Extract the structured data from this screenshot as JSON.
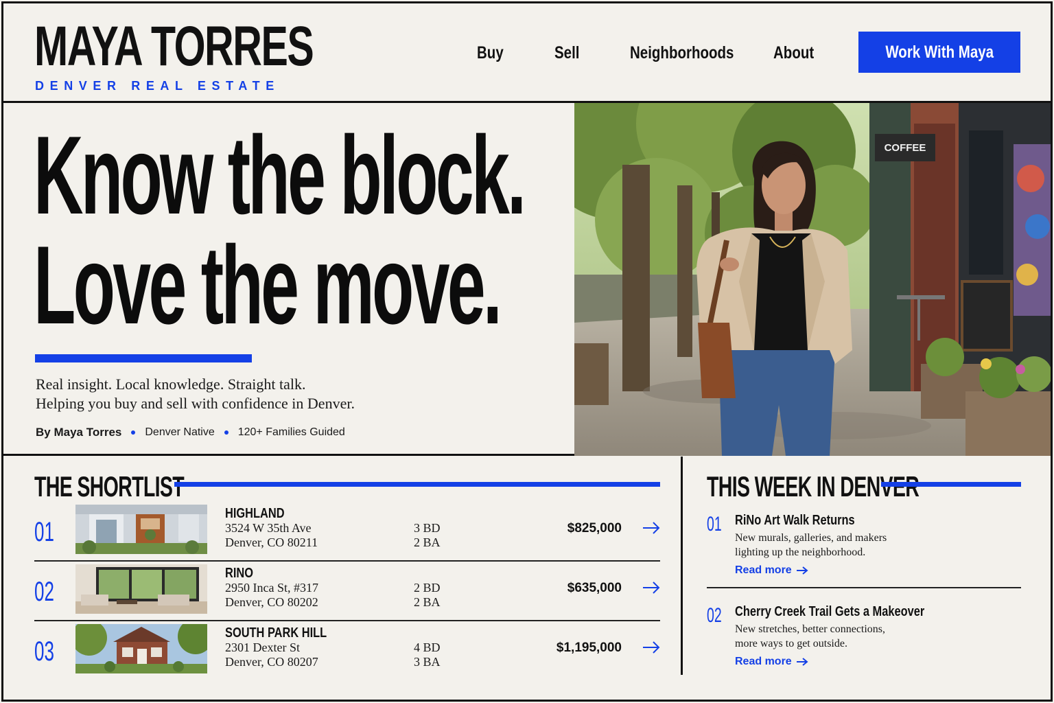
{
  "header": {
    "logo_name": "MAYA TORRES",
    "logo_sub": "DENVER REAL ESTATE",
    "nav": [
      "Buy",
      "Sell",
      "Neighborhoods",
      "About"
    ],
    "cta": "Work With Maya"
  },
  "hero": {
    "headline_1": "Know the block.",
    "headline_2": "Love the move.",
    "copy_1": "Real insight. Local knowledge. Straight talk.",
    "copy_2": "Helping you buy and sell with confidence in Denver.",
    "byline": "By Maya Torres",
    "tag_1": "Denver Native",
    "tag_2": "120+ Families Guided",
    "photo_signs": [
      "COFFEE"
    ]
  },
  "shortlist": {
    "title": "THE SHORTLIST",
    "items": [
      {
        "num": "01",
        "neighborhood": "HIGHLAND",
        "street": "3524 W 35th Ave",
        "city": "Denver, CO 80211",
        "beds": "3 BD",
        "baths": "2 BA",
        "price": "$825,000"
      },
      {
        "num": "02",
        "neighborhood": "RINO",
        "street": "2950 Inca St, #317",
        "city": "Denver, CO 80202",
        "beds": "2 BD",
        "baths": "2 BA",
        "price": "$635,000"
      },
      {
        "num": "03",
        "neighborhood": "SOUTH PARK HILL",
        "street": "2301 Dexter St",
        "city": "Denver, CO 80207",
        "beds": "4 BD",
        "baths": "3 BA",
        "price": "$1,195,000"
      }
    ]
  },
  "weekly": {
    "title": "THIS WEEK IN DENVER",
    "items": [
      {
        "num": "01",
        "title": "RiNo Art Walk Returns",
        "desc_1": "New murals, galleries, and makers",
        "desc_2": "lighting up the neighborhood.",
        "more": "Read more"
      },
      {
        "num": "02",
        "title": "Cherry Creek Trail Gets a Makeover",
        "desc_1": "New stretches, better connections,",
        "desc_2": "more ways to get outside.",
        "more": "Read more"
      }
    ]
  },
  "colors": {
    "accent": "#1440e6",
    "ink": "#111111",
    "paper": "#f3f1ec"
  }
}
